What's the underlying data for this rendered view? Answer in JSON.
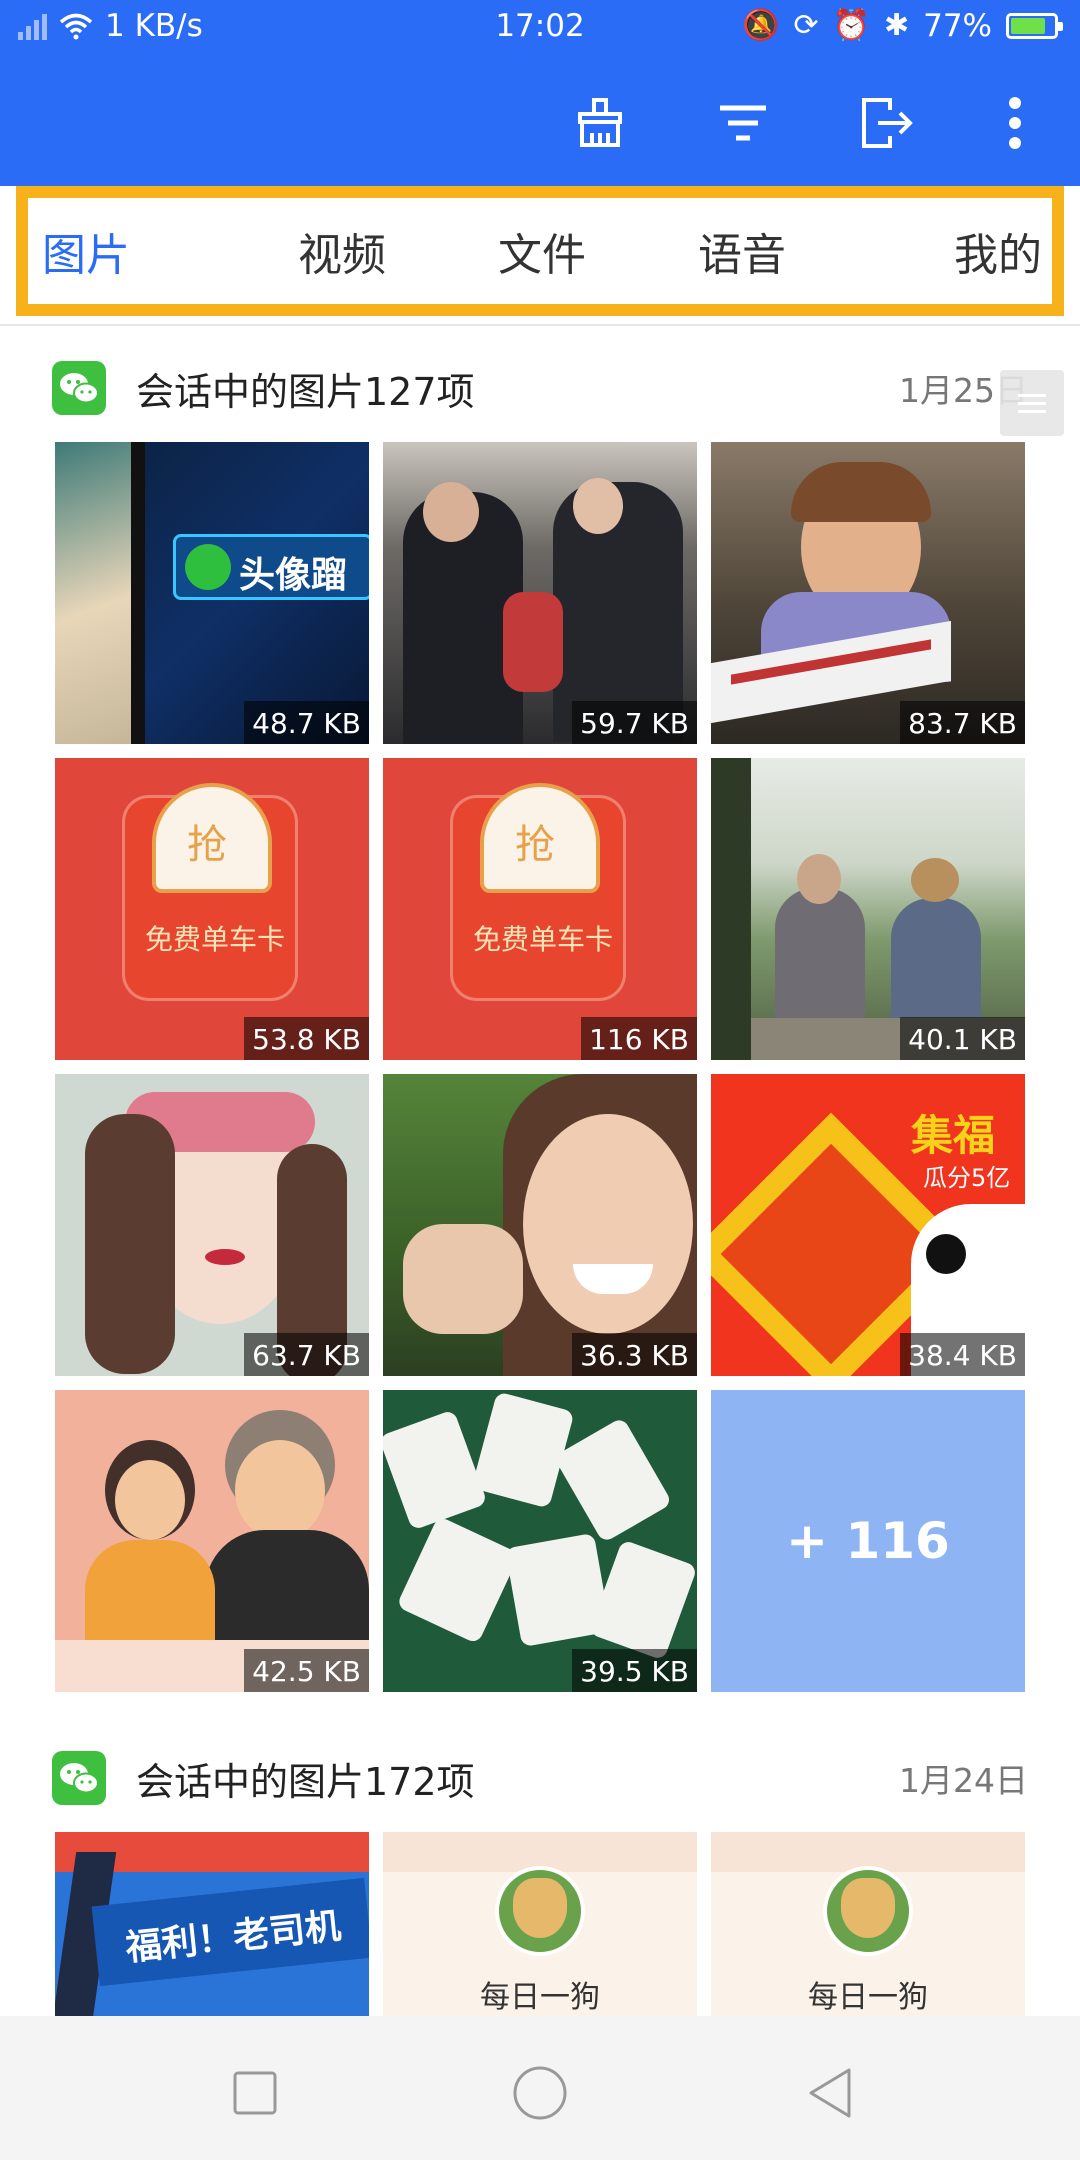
{
  "status_bar": {
    "network_speed": "1 KB/s",
    "time": "17:02",
    "battery_percent": "77%",
    "battery_level": 0.77
  },
  "tabs": [
    {
      "label": "图片",
      "active": true
    },
    {
      "label": "视频",
      "active": false
    },
    {
      "label": "文件",
      "active": false
    },
    {
      "label": "语音",
      "active": false
    },
    {
      "label": "我的",
      "active": false
    }
  ],
  "sections": [
    {
      "title": "会话中的图片127项",
      "date": "1月25日",
      "items": [
        {
          "size": "48.7 KB",
          "overlay_text": "头像蹓"
        },
        {
          "size": "59.7 KB"
        },
        {
          "size": "83.7 KB"
        },
        {
          "size": "53.8 KB",
          "badge": "抢",
          "caption": "免费单车卡"
        },
        {
          "size": "116 KB",
          "badge": "抢",
          "caption": "免费单车卡"
        },
        {
          "size": "40.1 KB"
        },
        {
          "size": "63.7 KB"
        },
        {
          "size": "36.3 KB"
        },
        {
          "size": "38.4 KB",
          "headline": "集福",
          "subline": "瓜分5亿"
        },
        {
          "size": "42.5 KB"
        },
        {
          "size": "39.5 KB"
        }
      ],
      "more_label": "+ 116"
    },
    {
      "title": "会话中的图片172项",
      "date": "1月24日",
      "items": [
        {
          "banner": "福利！老司机"
        },
        {
          "caption": "每日一狗"
        },
        {
          "caption": "每日一狗"
        }
      ]
    }
  ],
  "colors": {
    "app_blue": "#2b6cf6",
    "tab_highlight": "#f7b11b",
    "wechat_green": "#3fbf3f",
    "more_tile": "#8fb4f4"
  }
}
